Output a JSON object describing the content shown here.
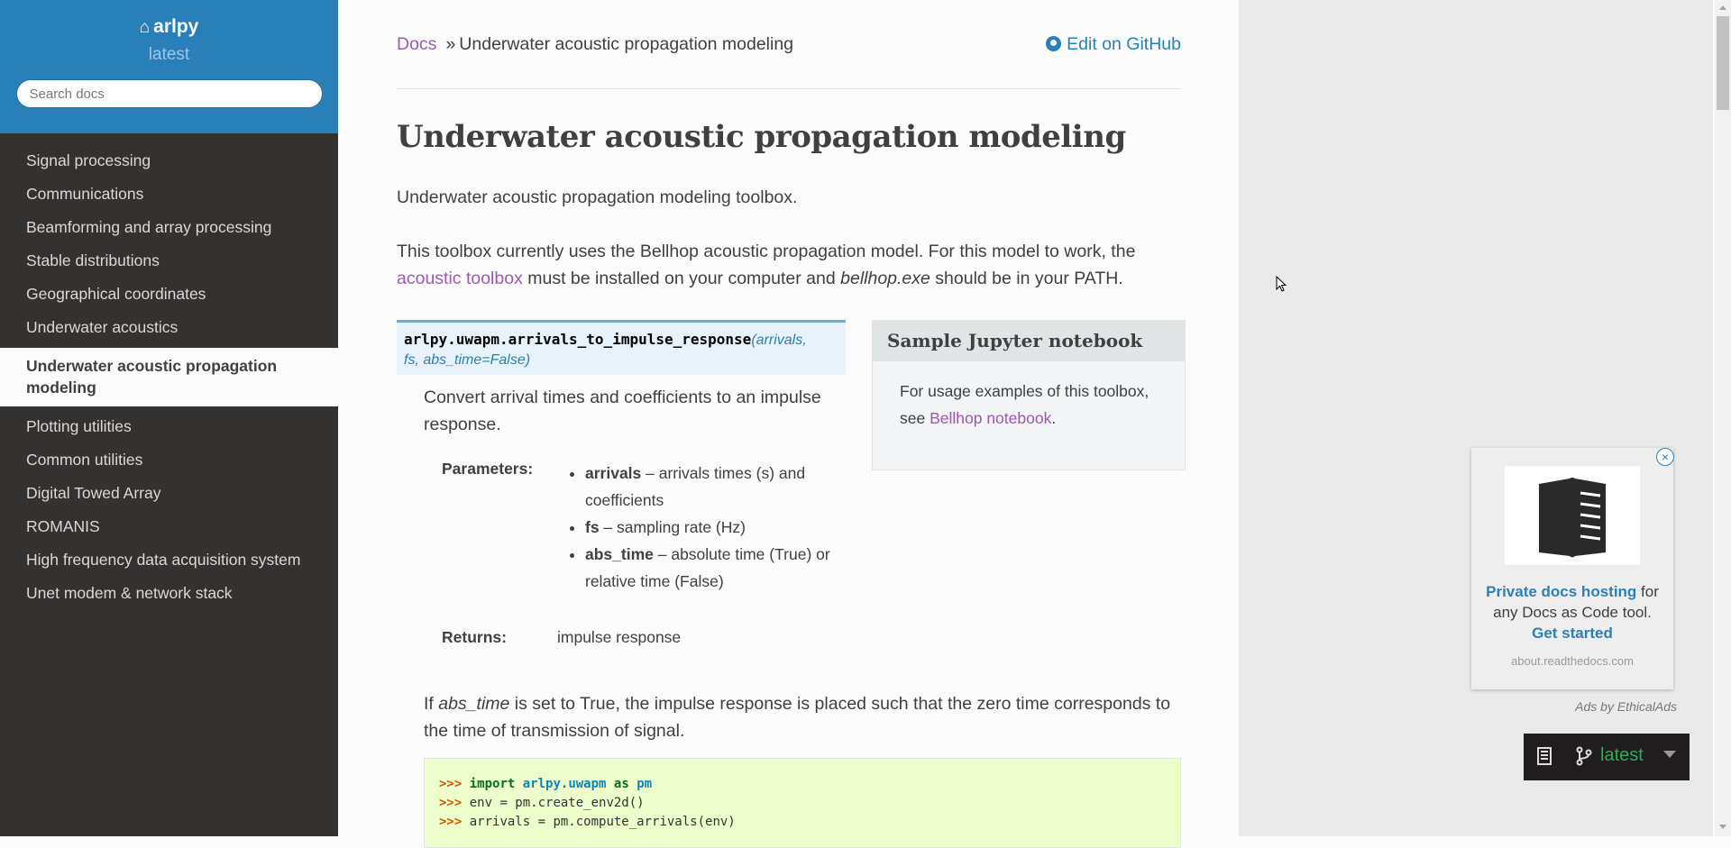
{
  "sidebar": {
    "project": "arlpy",
    "version": "latest",
    "search_placeholder": "Search docs",
    "items": [
      {
        "label": "Signal processing"
      },
      {
        "label": "Communications"
      },
      {
        "label": "Beamforming and array processing"
      },
      {
        "label": "Stable distributions"
      },
      {
        "label": "Geographical coordinates"
      },
      {
        "label": "Underwater acoustics"
      },
      {
        "label": "Underwater acoustic propagation modeling"
      },
      {
        "label": "Plotting utilities"
      },
      {
        "label": "Common utilities"
      },
      {
        "label": "Digital Towed Array"
      },
      {
        "label": "ROMANIS"
      },
      {
        "label": "High frequency data acquisition system"
      },
      {
        "label": "Unet modem & network stack"
      }
    ],
    "current_index": 6
  },
  "breadcrumb": {
    "root": "Docs",
    "separator": "»",
    "current": "Underwater acoustic propagation modeling",
    "edit_link": "Edit on GitHub"
  },
  "page": {
    "title": "Underwater acoustic propagation modeling",
    "intro": "Underwater acoustic propagation modeling toolbox.",
    "desc_part1": "This toolbox currently uses the Bellhop acoustic propagation model. For this model to work, the",
    "desc_link": "acoustic toolbox",
    "desc_part2": " must be installed on your computer and ",
    "desc_italic": "bellhop.exe",
    "desc_part3": " should be in your PATH."
  },
  "function": {
    "name": "arlpy.uwapm.arrivals_to_impulse_response",
    "args_open": "(arrivals,",
    "args_rest": "fs, abs_time=False)",
    "description": "Convert arrival times and coefficients to an impulse response.",
    "params_label": "Parameters:",
    "params": [
      {
        "name": "arrivals",
        "desc": " – arrivals times (s) and coefficients"
      },
      {
        "name": "fs",
        "desc": " – sampling rate (Hz)"
      },
      {
        "name": "abs_time",
        "desc": " – absolute time (True) or relative time (False)"
      }
    ],
    "returns_label": "Returns:",
    "returns_value": "impulse response",
    "note_part1": "If ",
    "note_italic": "abs_time",
    "note_part2": " is set to True, the impulse response is placed such that the zero time corresponds to the time of transmission of signal.",
    "code_lines": [
      {
        "prompt": ">>>",
        "text": "import arlpy.uwapm as pm"
      },
      {
        "prompt": ">>>",
        "text": "env = pm.create_env2d()"
      },
      {
        "prompt": ">>>",
        "text": "arrivals = pm.compute_arrivals(env)"
      }
    ]
  },
  "notebook_box": {
    "title": "Sample Jupyter notebook",
    "text": "For usage examples of this toolbox, see ",
    "link": "Bellhop notebook",
    "end": "."
  },
  "ad": {
    "close": "×",
    "headline": "Private docs hosting",
    "body": " for any Docs as Code tool. ",
    "cta": "Get started",
    "domain": "about.readthedocs.com",
    "by": "Ads by EthicalAds"
  },
  "versions": {
    "label": "latest"
  },
  "colors": {
    "sidebar_bg": "#343131",
    "sidebar_header": "#2980b9",
    "link": "#9b59b6",
    "accent": "#2980b9",
    "version_green": "#27ae60"
  }
}
